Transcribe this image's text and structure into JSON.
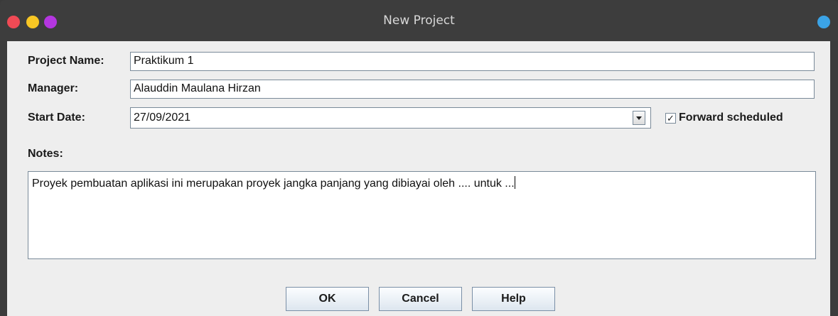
{
  "window": {
    "title": "New Project"
  },
  "form": {
    "project_name_label": "Project Name:",
    "project_name_value": "Praktikum 1",
    "manager_label": "Manager:",
    "manager_value": "Alauddin Maulana Hirzan",
    "start_date_label": "Start Date:",
    "start_date_value": "27/09/2021",
    "forward_scheduled_label": "Forward scheduled",
    "forward_scheduled_checked": true,
    "notes_label": "Notes:",
    "notes_value": "Proyek pembuatan aplikasi ini merupakan proyek jangka panjang yang dibiayai oleh .... untuk ..."
  },
  "buttons": {
    "ok_label": "OK",
    "cancel_label": "Cancel",
    "help_label": "Help"
  },
  "colors": {
    "close": "#f04a55",
    "minimize": "#f7c624",
    "maximize": "#b436e0",
    "extra": "#3ba3e6"
  }
}
